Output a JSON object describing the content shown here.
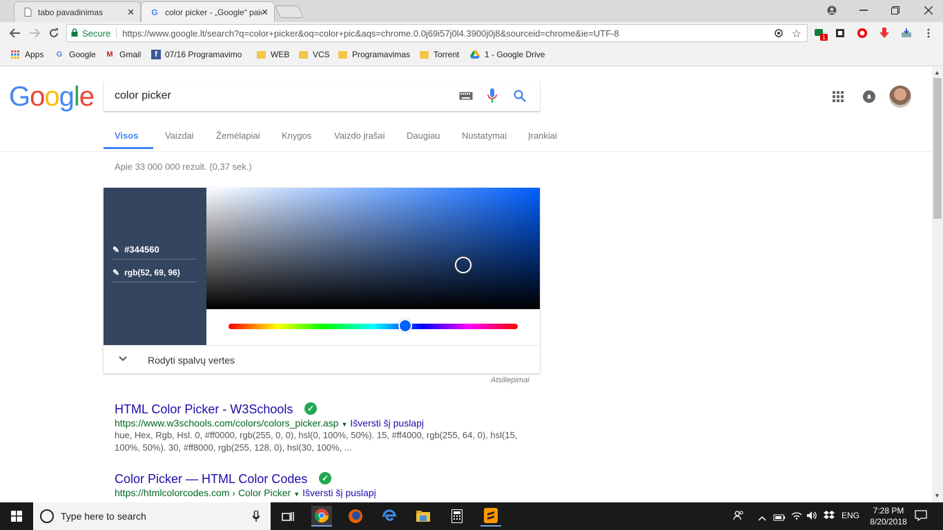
{
  "browser": {
    "tabs": [
      {
        "title": "tabo pavadinimas",
        "active": false
      },
      {
        "title": "color picker - „Google“ paieška",
        "active": true
      }
    ],
    "close_glyph": "✕",
    "url_secure_label": "Secure",
    "url": "https://www.google.lt/search?q=color+picker&oq=color+pic&aqs=chrome.0.0j69i57j0l4.3900j0j8&sourceid=chrome&ie=UTF-8",
    "extension_badge": "1",
    "bookmarks": [
      {
        "label": "Apps",
        "icon": "apps-grid-icon"
      },
      {
        "label": "Google",
        "icon": "google-icon"
      },
      {
        "label": "Gmail",
        "icon": "gmail-icon"
      },
      {
        "label": "07/16 Programavimo",
        "icon": "facebook-icon"
      },
      {
        "label": "WEB",
        "icon": "folder-icon"
      },
      {
        "label": "VCS",
        "icon": "folder-icon"
      },
      {
        "label": "Programavimas",
        "icon": "folder-icon"
      },
      {
        "label": "Torrent",
        "icon": "folder-icon"
      },
      {
        "label": "1 - Google Drive",
        "icon": "drive-icon"
      }
    ]
  },
  "google": {
    "logo_letters": [
      "G",
      "o",
      "o",
      "g",
      "l",
      "e"
    ],
    "logo_colors": [
      "#4285f4",
      "#ea4335",
      "#fbbc05",
      "#4285f4",
      "#34a853",
      "#ea4335"
    ],
    "query": "color picker",
    "nav_tabs": [
      "Visos",
      "Vaizdai",
      "Žemėlapiai",
      "Knygos",
      "Vaizdo įrašai",
      "Daugiau",
      "Nustatymai",
      "Įrankiai"
    ],
    "result_stats": "Apie 33 000 000 rezult. (0,37 sek.)"
  },
  "color_picker": {
    "hex": "#344560",
    "rgb": "rgb(52, 69, 96)",
    "hue_level": 0.61,
    "show_values_label": "Rodyti spalvų vertes",
    "feedback_label": "Atsiliepimai"
  },
  "results": [
    {
      "title": "HTML Color Picker - W3Schools",
      "url": "https://www.w3schools.com/colors/colors_picker.asp",
      "translate": "Išversti šį puslapį",
      "snippet": "hue, Hex, Rgb, Hsl. 0, #ff0000, rgb(255, 0, 0), hsl(0, 100%, 50%). 15, #ff4000, rgb(255, 64, 0), hsl(15, 100%, 50%). 30, #ff8000, rgb(255, 128, 0), hsl(30, 100%, ..."
    },
    {
      "title": "Color Picker — HTML Color Codes",
      "url": "https://htmlcolorcodes.com › Color Picker",
      "translate": "Išversti šį puslapį",
      "snippet": ""
    }
  ],
  "taskbar": {
    "search_placeholder": "Type here to search",
    "language": "ENG",
    "time": "7:28 PM",
    "date": "8/20/2018"
  }
}
